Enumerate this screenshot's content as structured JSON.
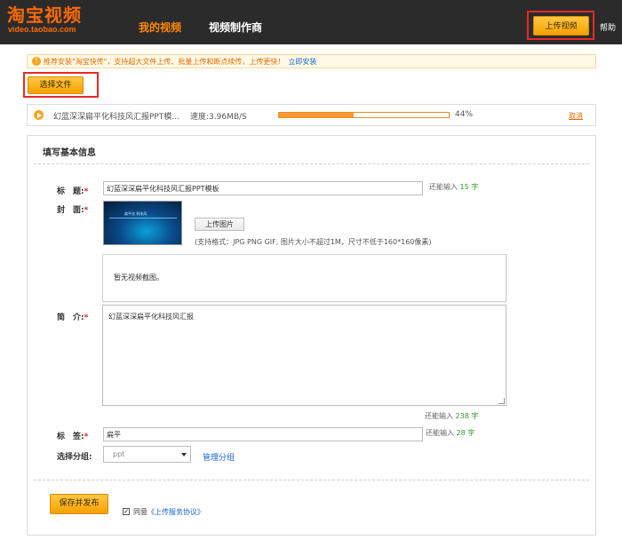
{
  "header": {
    "logo_main": "淘宝视频",
    "logo_sub": "video.taobao.com",
    "nav": [
      "我的视频",
      "视频制作商"
    ],
    "upload_button": "上传视频",
    "help": "帮助"
  },
  "notice": {
    "text": "推荐安装\"淘宝快传\"，支持超大文件上传、批量上传和断点续传，上传更快！",
    "link": "立即安装"
  },
  "select_file_button": "选择文件",
  "upload_item": {
    "file_name": "幻蓝深深扁平化科技风汇报PPT模...",
    "speed": "速度:3.96MB/S",
    "progress_percent": 44,
    "percent_text": "44%",
    "cancel": "取消"
  },
  "form": {
    "title": "填写基本信息",
    "title_field": {
      "label": "标　题:",
      "value": "幻蓝深深扁平化科技风汇报PPT模板",
      "hint_prefix": "还能输入",
      "count": "15",
      "hint_suffix": "字"
    },
    "cover": {
      "label": "封　面:",
      "thumb_caption": "扁平化 科技风",
      "upload_button": "上传图片",
      "hint": "(支持格式：JPG PNG GIF, 图片大小不超过1M，尺寸不低于160*160像素)",
      "snapshot_text": "暂无视频截图。"
    },
    "intro": {
      "label": "简　介:",
      "value": "幻蓝深深扁平化科技风汇报",
      "hint_prefix": "还能输入",
      "count": "238",
      "hint_suffix": "字"
    },
    "tags": {
      "label": "标　签:",
      "value": "扁平",
      "hint_prefix": "还能输入",
      "count": "28",
      "hint_suffix": "字"
    },
    "group": {
      "label": "选择分组:",
      "selected": "ppt",
      "manage_link": "管理分组"
    },
    "publish_button": "保存并发布",
    "agree_text": "同意",
    "agree_link": "《上传服务协议》",
    "agree_checked": true
  },
  "colors": {
    "accent": "#f5a100",
    "highlight_border": "#e52a2a",
    "link": "#1a66cc",
    "count_green": "#2e9a2e"
  }
}
